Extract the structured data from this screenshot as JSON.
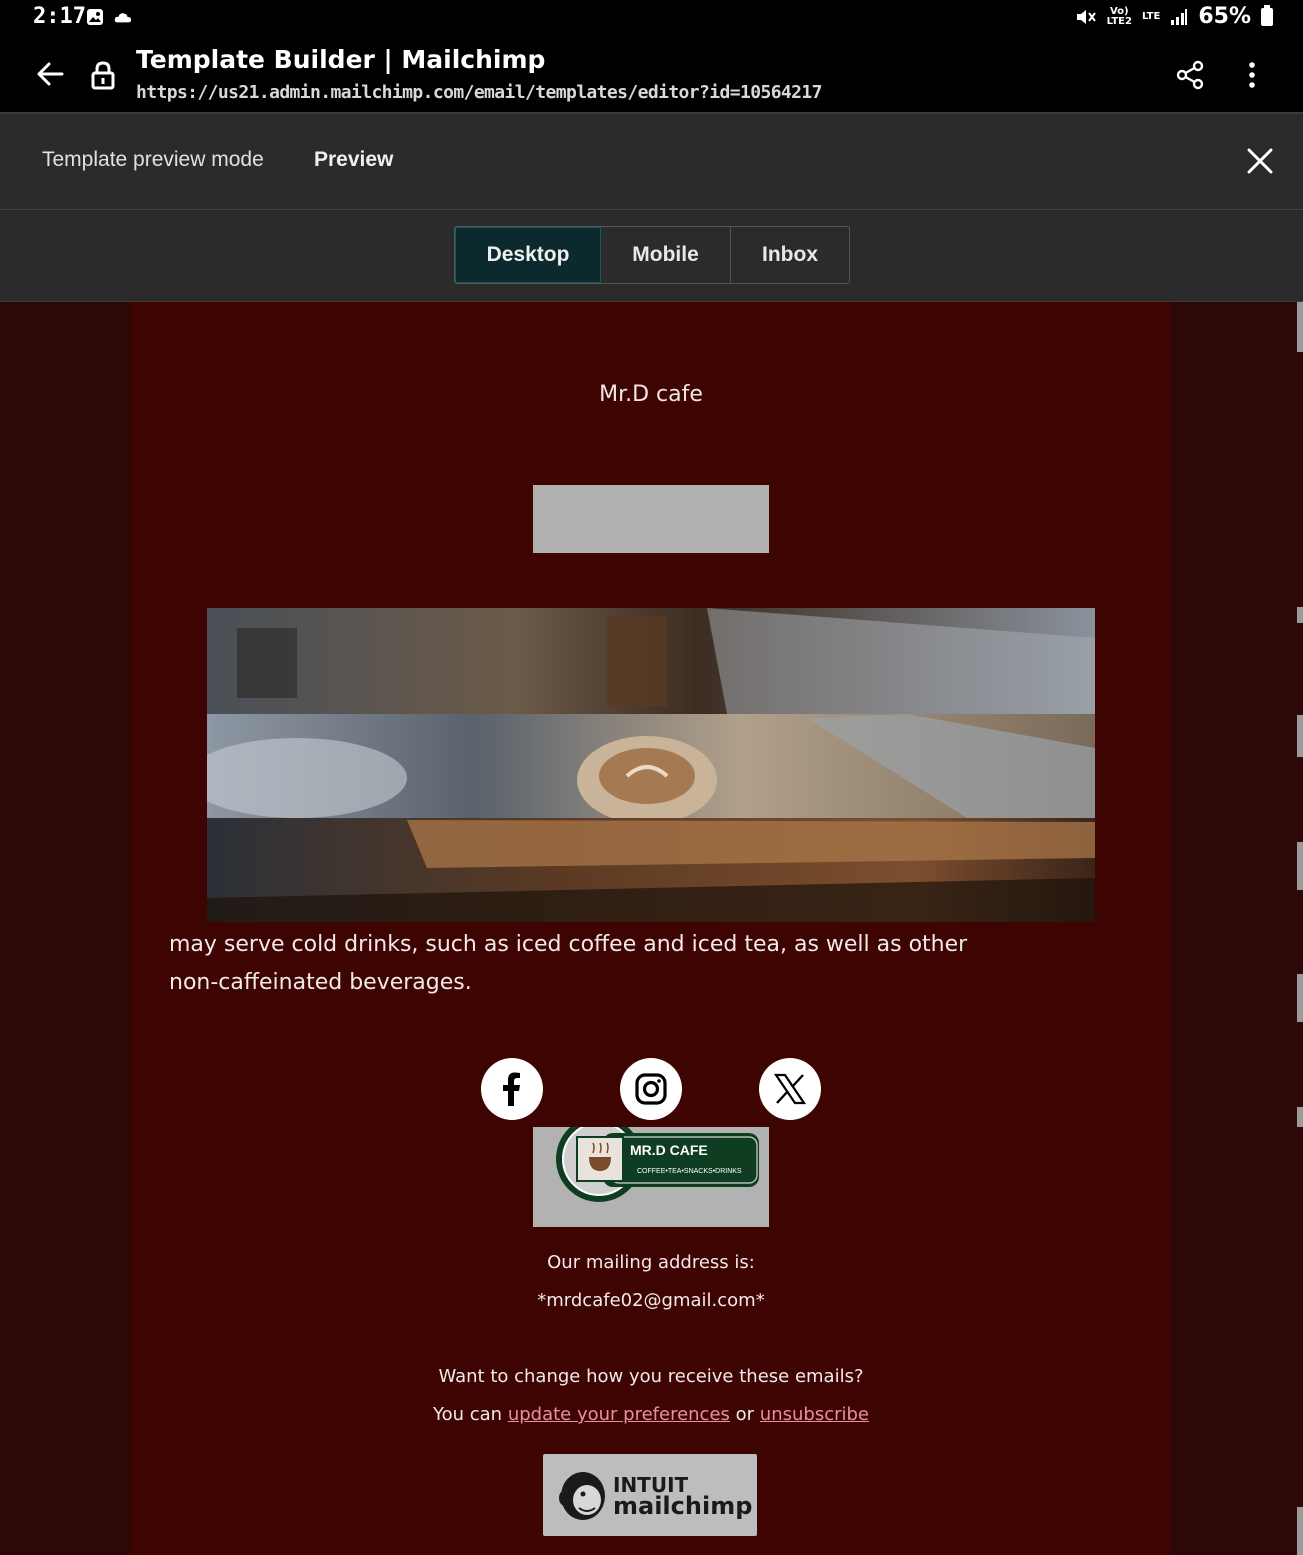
{
  "status_bar": {
    "time": "2:17",
    "volte_top": "Vo)",
    "volte_bottom": "LTE2",
    "lte": "LTE",
    "battery": "65%"
  },
  "browser": {
    "page_title": "Template Builder | Mailchimp",
    "url": "https://us21.admin.mailchimp.com/email/templates/editor?id=10564217"
  },
  "preview_bar": {
    "mode_label": "Template preview mode",
    "preview_label": "Preview"
  },
  "tabs": [
    {
      "label": "Desktop",
      "active": true
    },
    {
      "label": "Mobile",
      "active": false
    },
    {
      "label": "Inbox",
      "active": false
    }
  ],
  "email": {
    "brand_name": "Mr.D cafe",
    "body_text_line1": "may serve cold drinks, such as iced coffee and iced tea, as well as other",
    "body_text_line2": "non-caffeinated beverages.",
    "socials": [
      "facebook-icon",
      "instagram-icon",
      "x-icon"
    ],
    "logo_title": "MR.D CAFE",
    "logo_subtitle": "COFFEE•TEA•SNACKS•DRINKS",
    "mailing_label": "Our mailing address is:",
    "mailing_email": "*mrdcafe02@gmail.com*",
    "change_question": "Want to change how you receive these emails?",
    "you_can": "You can",
    "update_link": "update your preferences",
    "or_text": "or",
    "unsubscribe_link": "unsubscribe",
    "badge_top": "INTUIT",
    "badge_bottom": "mailchimp"
  },
  "colors": {
    "email_bg": "#3e0402",
    "outer_bg": "#2d0807",
    "tab_active_bg": "#0c2a2e",
    "link": "#e88fa0"
  }
}
